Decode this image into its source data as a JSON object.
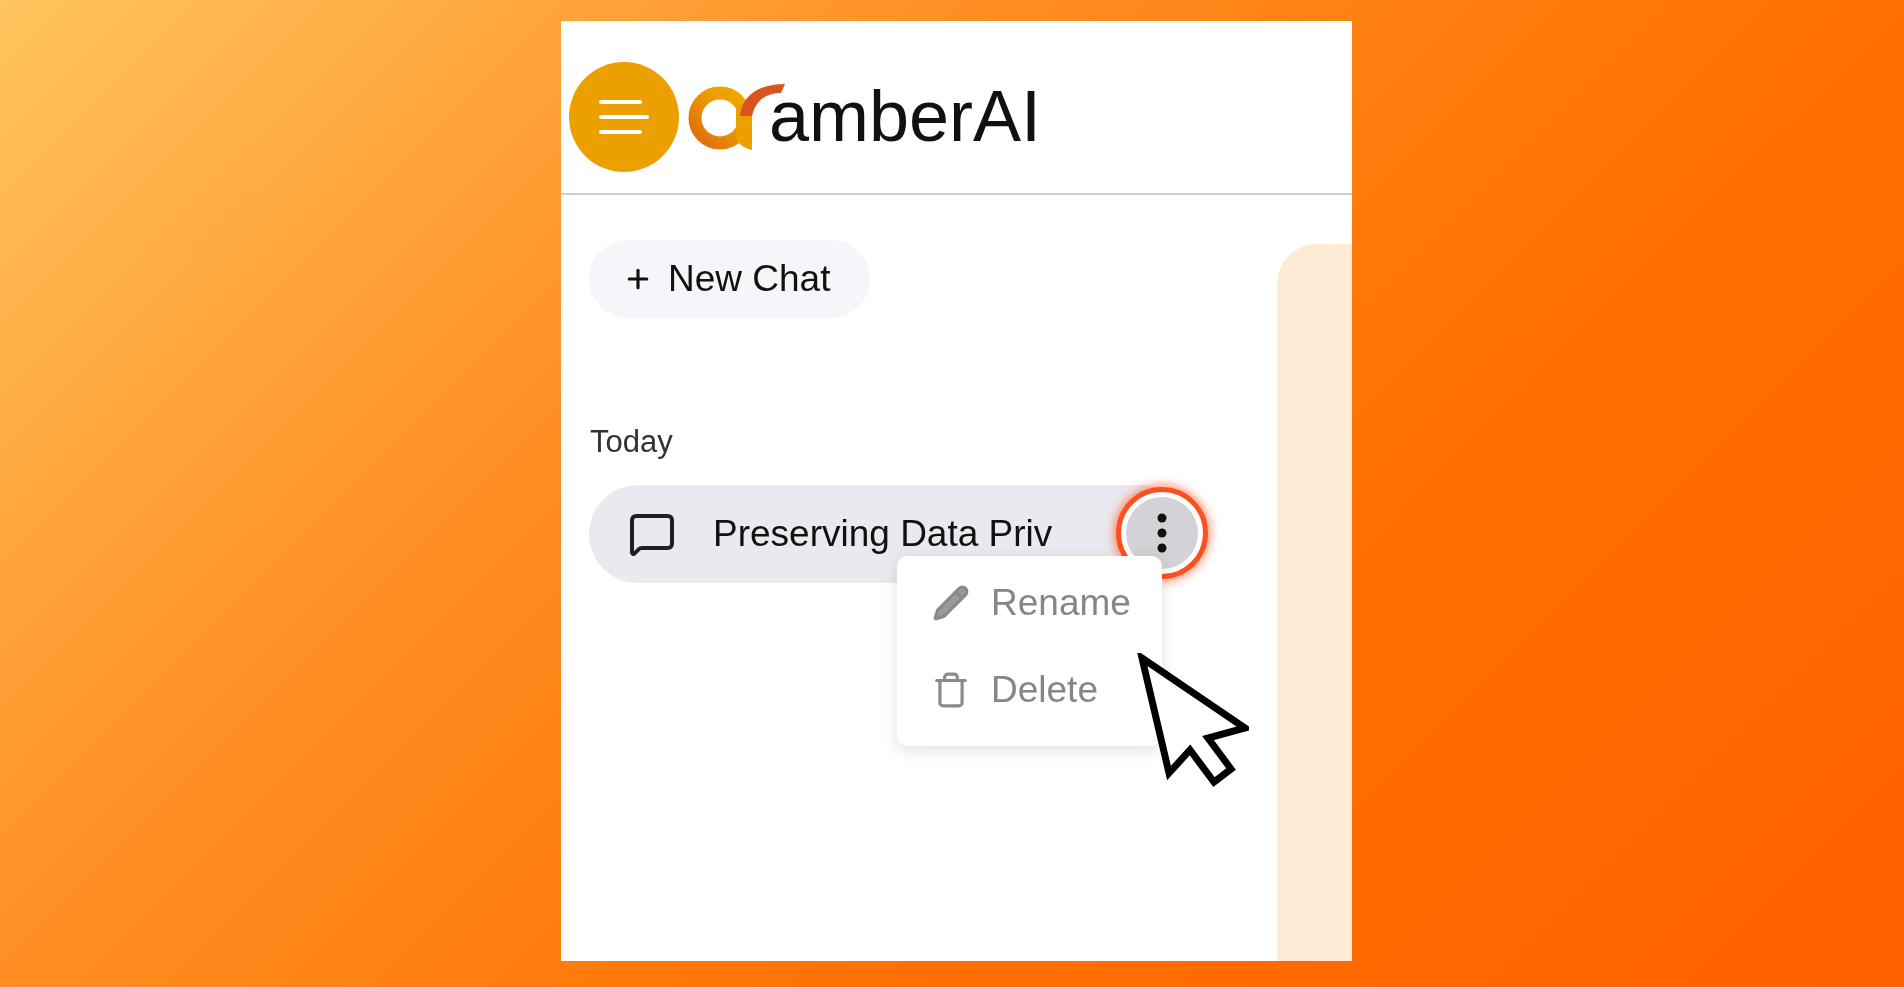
{
  "header": {
    "logo_text": "amberAI"
  },
  "new_chat": {
    "label": "New Chat"
  },
  "history": [
    {
      "heading": "Today",
      "chats": [
        {
          "title": "Preserving Data Priv",
          "selected": true,
          "menu": {
            "open": true,
            "items": [
              {
                "kind": "rename",
                "label": "Rename"
              },
              {
                "kind": "delete",
                "label": "Delete"
              }
            ]
          }
        }
      ]
    }
  ]
}
